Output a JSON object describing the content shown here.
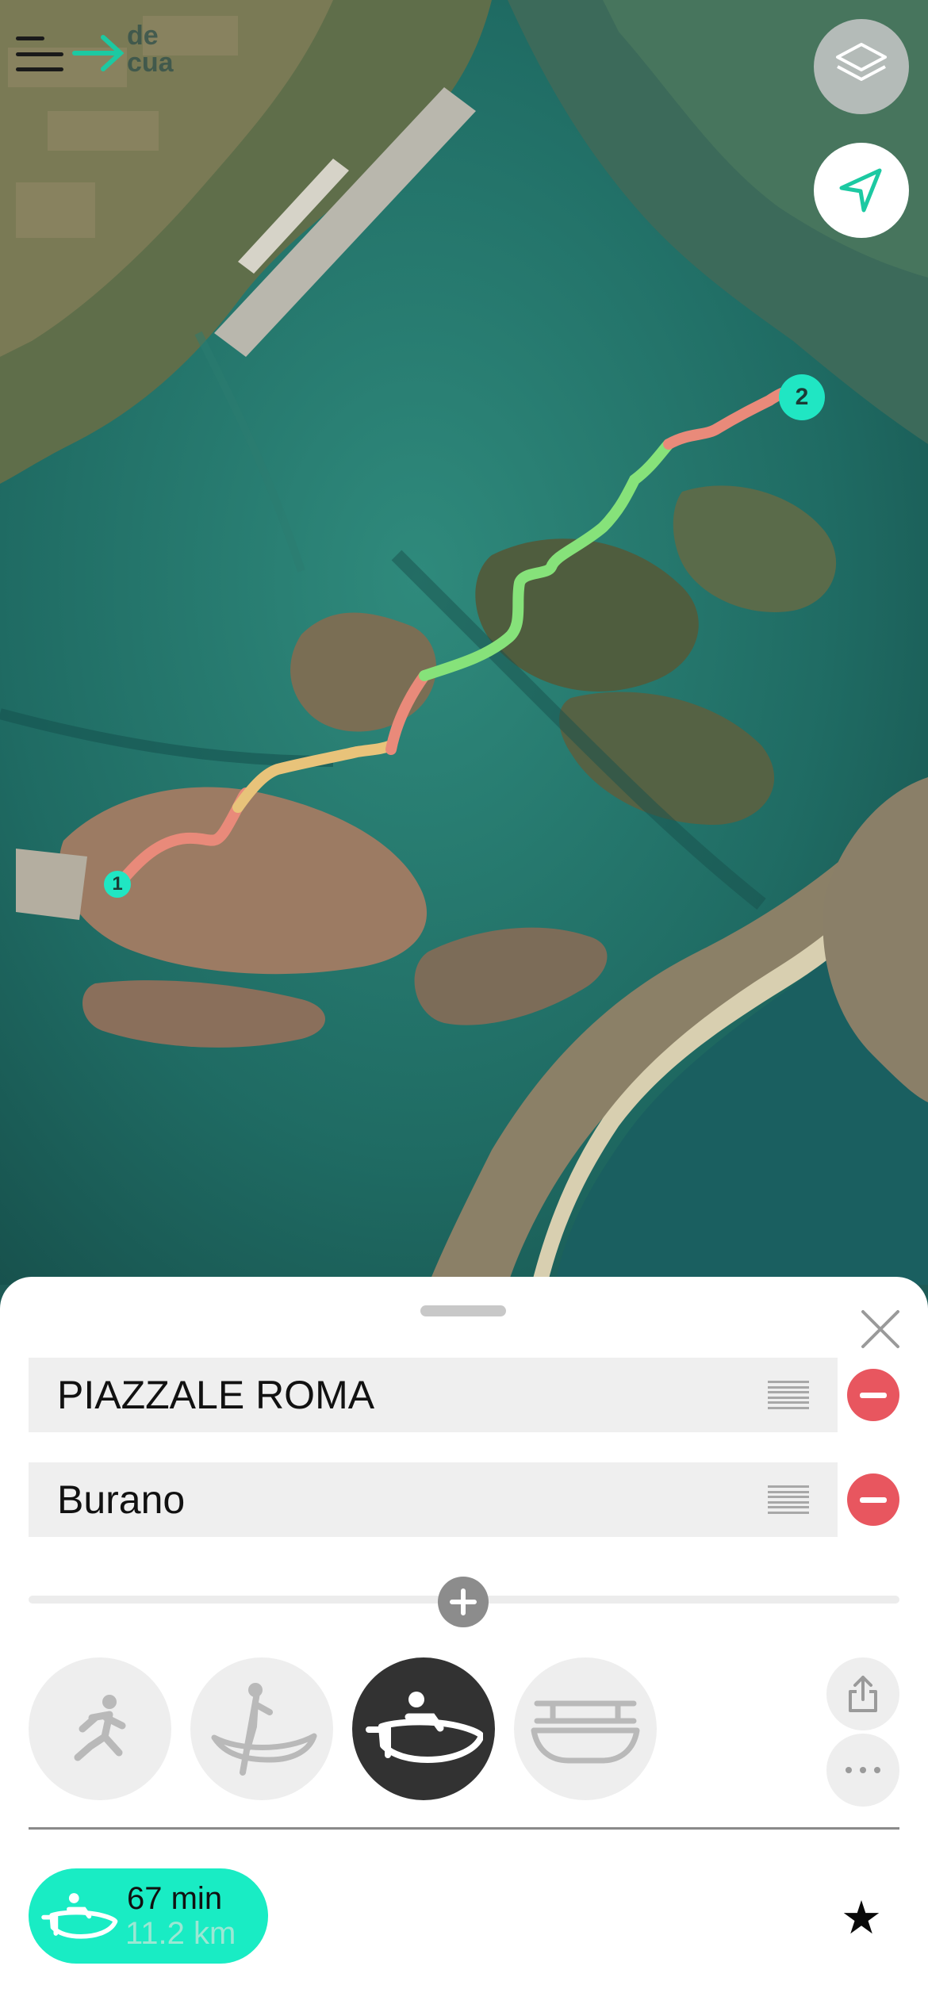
{
  "map": {
    "type": "satellite",
    "route_segment_colors": {
      "slow": "#e98a7a",
      "medium": "#e8c37a",
      "fast": "#86e27a"
    },
    "markers": [
      {
        "label": "1"
      },
      {
        "label": "2"
      }
    ]
  },
  "header": {
    "logo_text_line1": "de",
    "logo_text_line2": "cua",
    "menu_icon": "hamburger-icon"
  },
  "controls": {
    "layers_icon": "layers-icon",
    "locate_icon": "navigation-arrow-icon"
  },
  "sheet": {
    "stops": [
      {
        "name": "PIAZZALE ROMA"
      },
      {
        "name": "Burano"
      }
    ],
    "modes": [
      {
        "icon": "walking-icon",
        "selected": false
      },
      {
        "icon": "gondola-icon",
        "selected": false
      },
      {
        "icon": "motorboat-icon",
        "selected": true
      },
      {
        "icon": "ferry-icon",
        "selected": false
      }
    ],
    "result": {
      "duration": "67 min",
      "distance": "11.2 km"
    },
    "accent": "#19ecc4",
    "remove_color": "#e8565f"
  }
}
